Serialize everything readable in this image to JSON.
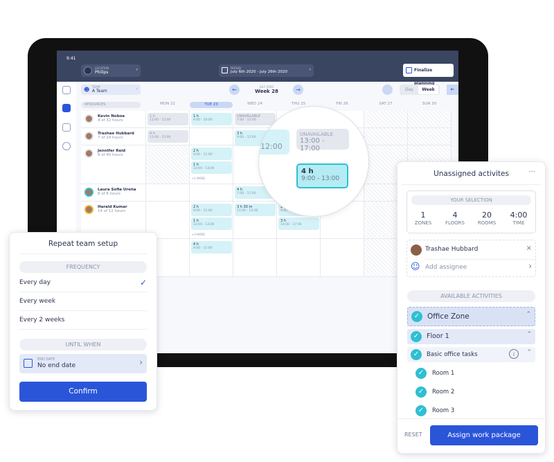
{
  "status": {
    "time": "9:41"
  },
  "header": {
    "location_label": "LOCATION",
    "location": "Philips",
    "period_label": "PERIOD",
    "period": "July 6th 2020 - July 26th 2020",
    "finalize": "Finalize planning"
  },
  "toolbar": {
    "team_label": "TEAM",
    "team": "A Team",
    "month": "JULY 2020",
    "week": "Week 28",
    "day": "Day",
    "week_btn": "Week"
  },
  "columns": {
    "resources": "RESOURCES",
    "days": [
      "MON 22",
      "TUE 23",
      "WED 24",
      "THU 25",
      "FRI 26",
      "SAT 27",
      "SUN 30"
    ],
    "selected_day": 1
  },
  "resources": [
    {
      "name": "Kevin Noboa",
      "hours": "4 of 32 hours"
    },
    {
      "name": "Trashae Hubbard",
      "hours": "7 of 24 hours"
    },
    {
      "name": "Jennifer Reid",
      "hours": "8 of 40 hours"
    },
    {
      "name": "Laura Sofia Ureña",
      "hours": "8 of 8 hours"
    },
    {
      "name": "Harald Kumar",
      "hours": "14 of 12 hours"
    }
  ],
  "events": [
    {
      "row": 0,
      "day": 0,
      "title": "1 h",
      "time": "11:00 - 12:00",
      "unavailable": true,
      "slot": 0
    },
    {
      "row": 0,
      "day": 1,
      "title": "1 h",
      "time": "9:00 - 10:00",
      "slot": 0
    },
    {
      "row": 0,
      "day": 2,
      "title": "UNAVAILABLE",
      "time": "7:00 - 12:00",
      "unavailable": true,
      "slot": 0
    },
    {
      "row": 1,
      "day": 0,
      "title": "4 h",
      "time": "11:00 - 15:00",
      "unavailable": true,
      "slot": 0
    },
    {
      "row": 1,
      "day": 2,
      "title": "3 h",
      "time": "9:00 - 12:00",
      "slot": 0
    },
    {
      "row": 2,
      "day": 1,
      "title": "2 h",
      "time": "9:00 - 11:00",
      "slot": 0
    },
    {
      "row": 2,
      "day": 1,
      "title": "1 h",
      "time": "12:00 - 13:00",
      "slot": 1
    },
    {
      "row": 3,
      "day": 2,
      "title": "4 h",
      "time": "7:00 - 11:00",
      "slot": 0
    },
    {
      "row": 4,
      "day": 1,
      "title": "2 h",
      "time": "9:00 - 11:00",
      "slot": 0
    },
    {
      "row": 4,
      "day": 1,
      "title": "1 h",
      "time": "12:00 - 13:00",
      "slot": 1
    },
    {
      "row": 4,
      "day": 2,
      "title": "3 h 30 m",
      "time": "11:00 - 14:30",
      "slot": 0
    },
    {
      "row": 4,
      "day": 3,
      "title": "2 h",
      "time": "9:00 - 11:00",
      "slot": 0
    },
    {
      "row": 4,
      "day": 3,
      "title": "3 h",
      "time": "14:00 - 17:00",
      "slot": 1
    },
    {
      "row": 5,
      "day": 1,
      "title": "4 h",
      "time": "8:00 - 11:00",
      "slot": 0
    }
  ],
  "more": [
    {
      "row": 2,
      "day": 1,
      "label": "+1 MORE"
    },
    {
      "row": 4,
      "day": 1,
      "label": "+3 MORE"
    }
  ],
  "magnifier": {
    "partial": "12:00",
    "unavailable_title": "UNAVAILABLE",
    "unavailable_time": "13:00 - 17:00",
    "event_title": "4 h",
    "event_time": "9:00 - 13:00"
  },
  "repeat": {
    "title": "Repeat team setup",
    "frequency": "FREQUENCY",
    "options": [
      "Every day",
      "Every week",
      "Every 2 weeks"
    ],
    "selected": 0,
    "until": "UNTIL WHEN",
    "end_label": "END DATE",
    "end_value": "No end date",
    "confirm": "Confirm"
  },
  "unassigned": {
    "title": "Unassigned activites",
    "menu": "···",
    "selection": "YOUR SELECTION",
    "stats": [
      {
        "v": "1",
        "l": "ZONES"
      },
      {
        "v": "4",
        "l": "FLOORS"
      },
      {
        "v": "20",
        "l": "ROOMS"
      },
      {
        "v": "4:00",
        "l": "TIME"
      }
    ],
    "assignee": "Trashae Hubbard",
    "add": "Add assignee",
    "available": "AVAILABLE ACTIVITIES",
    "zone": "Office Zone",
    "floor": "Floor 1",
    "tasks": "Basic office tasks",
    "rooms": [
      "Room 1",
      "Room 2",
      "Room 3"
    ],
    "reset": "RESET",
    "assign": "Assign work package"
  },
  "colors": {
    "accent": "#2b55d9",
    "teal": "#2ebfd3",
    "header": "#3a4562"
  }
}
